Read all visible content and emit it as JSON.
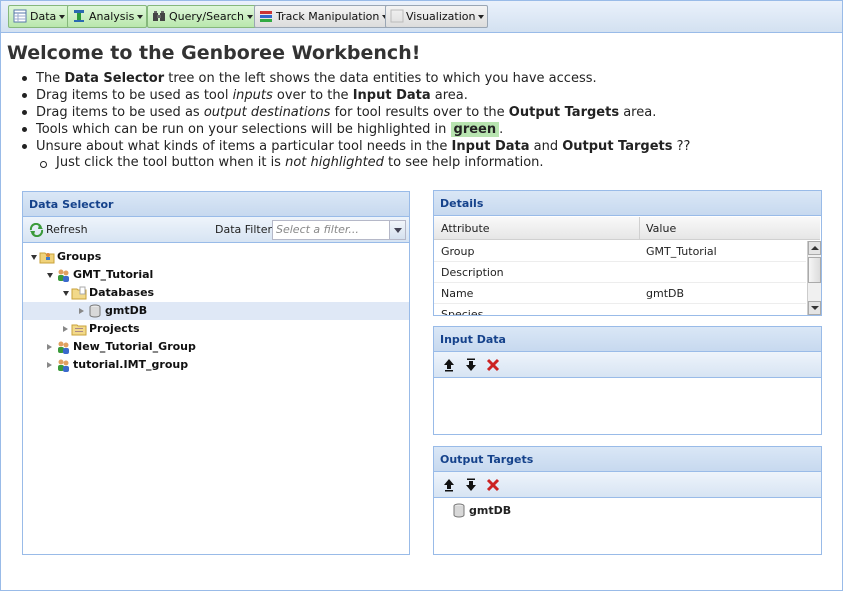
{
  "toolbar": {
    "buttons": [
      {
        "label": "Data",
        "icon": "table-icon"
      },
      {
        "label": "Analysis",
        "icon": "analysis-icon"
      },
      {
        "label": "Query/Search",
        "icon": "binoculars-icon"
      },
      {
        "label": "Track Manipulation",
        "icon": "tracks-icon"
      },
      {
        "label": "Visualization",
        "icon": "visualization-icon"
      }
    ]
  },
  "welcome": {
    "title": "Welcome to the Genboree Workbench!",
    "b1": {
      "a": "The ",
      "b": "Data Selector",
      "c": " tree on the left shows the data entities to which you have access."
    },
    "b2": {
      "a": "Drag items to be used as tool ",
      "b": "inputs",
      "c": " over to the ",
      "d": "Input Data",
      "e": " area."
    },
    "b3": {
      "a": "Drag items to be used as ",
      "b": "output destinations",
      "c": " for tool results over to the ",
      "d": "Output Targets",
      "e": " area."
    },
    "b4": {
      "a": "Tools which can be run on your selections will be highlighted in ",
      "b": "green",
      "c": "."
    },
    "b5": {
      "a": "Unsure about what kinds of items a particular tool needs in the ",
      "b": "Input Data",
      "c": " and ",
      "d": "Output Targets",
      "e": " ??"
    },
    "b6": {
      "a": "Just click the tool button when it is ",
      "b": "not highlighted",
      "c": " to see help information."
    }
  },
  "data_selector": {
    "title": "Data Selector",
    "refresh_label": "Refresh",
    "filter_label": "Data Filter:",
    "filter_placeholder": "Select a filter...",
    "tree": [
      {
        "label": "Groups",
        "icon": "group-folder-icon"
      },
      {
        "label": "GMT_Tutorial",
        "icon": "users-icon"
      },
      {
        "label": "Databases",
        "icon": "folder-icon"
      },
      {
        "label": "gmtDB",
        "icon": "database-icon"
      },
      {
        "label": "Projects",
        "icon": "projects-folder-icon"
      },
      {
        "label": "New_Tutorial_Group",
        "icon": "users-icon"
      },
      {
        "label": "tutorial.IMT_group",
        "icon": "users-icon"
      }
    ]
  },
  "details": {
    "title": "Details",
    "columns": [
      "Attribute",
      "Value"
    ],
    "rows": [
      {
        "attr": "Group",
        "value": "GMT_Tutorial"
      },
      {
        "attr": "Description",
        "value": ""
      },
      {
        "attr": "Name",
        "value": "gmtDB"
      },
      {
        "attr": "Species",
        "value": ""
      }
    ]
  },
  "input_data": {
    "title": "Input Data"
  },
  "output_targets": {
    "title": "Output Targets",
    "items": [
      "gmtDB"
    ]
  },
  "colors": {
    "accent": "#15428b",
    "panel_border": "#99bbe8",
    "highlight_green": "#b8e4b0"
  }
}
